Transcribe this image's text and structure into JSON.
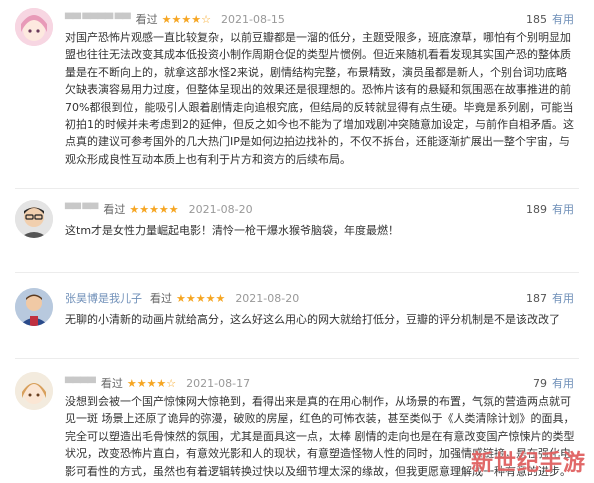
{
  "reviews": [
    {
      "user": "▀▀ ▀▀▀▀ ▀▀",
      "status": "看过",
      "stars": "★★★★☆",
      "date": "2021-08-15",
      "useful_count": "185",
      "useful_label": "有用",
      "text": "对国产恐怖片观感一直比较复杂，以前豆瓣都是一溜的低分，主题受限多，班底潦草，哪怕有个别明显加盟也往往无法改变其成本低投资小制作周期仓促的类型片惯例。但近来随机看看发现其实国产恐的整体质量是在不断向上的，就拿这部水怪2来说，剧情结构完整，布景精致，演员虽都是新人，个别台词功底略欠缺表演容易用力过度，但整体呈现出的效果还是很理想的。恐怖片该有的悬疑和氛围恶在故事推进的前70%都很到位，能吸引人跟着剧情走向追根究底，但结局的反转就显得有点生硬。毕竟是系列剧，可能当初拍1的时候并未考虑到2的延伸，但反之如今也不能为了增加戏剧冲突随意加设定，与前作自相矛盾。这点真的建议可参考国外的几大热门IP是如何边拍边找补的，不仅不拆台，还能逐渐扩展出一整个宇宙，与观众形成良性互动本质上也有利于片方和资方的后续布局。"
    },
    {
      "user": "▀▀ ▀▀ ",
      "status": "看过",
      "stars": "★★★★★",
      "date": "2021-08-20",
      "useful_count": "189",
      "useful_label": "有用",
      "text": "这tm才是女性力量崛起电影！清怜一枪干爆水猴爷脑袋，年度最燃！"
    },
    {
      "user": "张昊博是我儿子",
      "status": "看过",
      "stars": "★★★★★",
      "date": "2021-08-20",
      "useful_count": "187",
      "useful_label": "有用",
      "text": "无聊的小清新的动画片就给高分，这么好这么用心的网大就给打低分，豆瓣的评分机制是不是该改改了"
    },
    {
      "user": "▀▀▀▀ ",
      "status": "看过",
      "stars": "★★★★☆",
      "date": "2021-08-17",
      "useful_count": "79",
      "useful_label": "有用",
      "text": "没想到会被一个国产惊悚网大惊艳到，看得出来是真的在用心制作，从场景的布置，气氛的营造两点就可见一斑 场景上还原了诡异的弥漫，破败的房屋，红色的可怖衣装，甚至类似于《人类清除计划》的面具，完全可以塑造出毛骨悚然的氛围，尤其是面具这一点，太棒 剧情的走向也是在有意改变国产惊悚片的类型状况，改变恐怖片直白，有意效光影和人的现状，有意塑造怪物人性的同时，加强情感链接，是在强化电影可看性的方式，虽然也有着逻辑转换过快以及细节埋太深的缘故，但我更愿意理解成一种有意的进步。"
    }
  ],
  "watermark": "新世纪手游"
}
